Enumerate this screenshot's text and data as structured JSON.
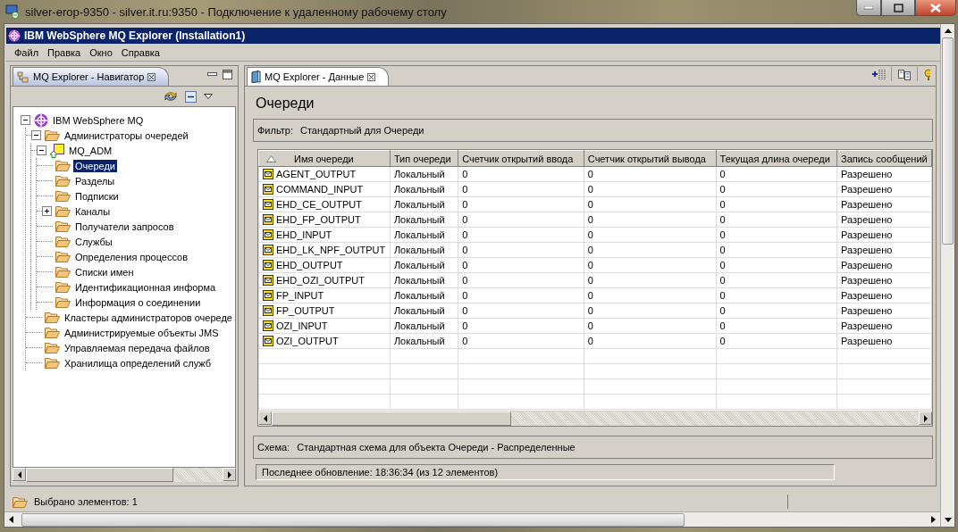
{
  "remote_window": {
    "title": "silver-erop-9350 - silver.it.ru:9350 - Подключение к удаленному рабочему столу"
  },
  "app": {
    "title": "IBM WebSphere MQ Explorer (Installation1)"
  },
  "menu": [
    "Файл",
    "Правка",
    "Окно",
    "Справка"
  ],
  "navigator": {
    "tab": {
      "label": "MQ Explorer - Навигатор",
      "active": true
    },
    "tree": [
      {
        "label": "IBM WebSphere MQ",
        "kind": "root",
        "expanded": true,
        "selected": false,
        "children": [
          {
            "label": "Администраторы очередей",
            "kind": "folder",
            "expanded": true,
            "selected": false,
            "children": [
              {
                "label": "MQ_ADM",
                "kind": "queue-manager",
                "expanded": true,
                "selected": false,
                "children": [
                  {
                    "label": "Очереди",
                    "kind": "folder",
                    "selected": true
                  },
                  {
                    "label": "Разделы",
                    "kind": "folder",
                    "selected": false
                  },
                  {
                    "label": "Подписки",
                    "kind": "folder",
                    "selected": false
                  },
                  {
                    "label": "Каналы",
                    "kind": "folder",
                    "expanded": false,
                    "selected": false
                  },
                  {
                    "label": "Получатели запросов",
                    "kind": "folder",
                    "selected": false
                  },
                  {
                    "label": "Службы",
                    "kind": "folder",
                    "selected": false
                  },
                  {
                    "label": "Определения процессов",
                    "kind": "folder",
                    "selected": false
                  },
                  {
                    "label": "Списки имен",
                    "kind": "folder",
                    "selected": false
                  },
                  {
                    "label": "Идентификационная информа",
                    "kind": "folder",
                    "selected": false
                  },
                  {
                    "label": "Информация о соединении",
                    "kind": "folder",
                    "selected": false
                  }
                ]
              }
            ]
          },
          {
            "label": "Кластеры администраторов очереде",
            "kind": "folder",
            "selected": false
          },
          {
            "label": "Администрируемые объекты JMS",
            "kind": "folder",
            "selected": false
          },
          {
            "label": "Управляемая передача файлов",
            "kind": "folder",
            "selected": false
          },
          {
            "label": "Хранилища определений служб",
            "kind": "folder",
            "selected": false
          }
        ]
      }
    ]
  },
  "content": {
    "tab": {
      "label": "MQ Explorer - Данные",
      "active": false
    },
    "heading": "Очереди",
    "filter": {
      "label": "Фильтр:",
      "value": "Стандартный для Очереди"
    },
    "table": {
      "columns": [
        {
          "label": "Имя очереди",
          "sorted": true
        },
        {
          "label": "Тип очереди",
          "sorted": false
        },
        {
          "label": "Счетчик открытий ввода",
          "sorted": false
        },
        {
          "label": "Счетчик открытий вывода",
          "sorted": false
        },
        {
          "label": "Текущая длина очереди",
          "sorted": false
        },
        {
          "label": "Запись сообщений",
          "sorted": false
        }
      ],
      "rows": [
        {
          "cells": [
            "AGENT_OUTPUT",
            "Локальный",
            "0",
            "0",
            "0",
            "Разрешено"
          ]
        },
        {
          "cells": [
            "COMMAND_INPUT",
            "Локальный",
            "0",
            "0",
            "0",
            "Разрешено"
          ]
        },
        {
          "cells": [
            "EHD_CE_OUTPUT",
            "Локальный",
            "0",
            "0",
            "0",
            "Разрешено"
          ]
        },
        {
          "cells": [
            "EHD_FP_OUTPUT",
            "Локальный",
            "0",
            "0",
            "0",
            "Разрешено"
          ]
        },
        {
          "cells": [
            "EHD_INPUT",
            "Локальный",
            "0",
            "0",
            "0",
            "Разрешено"
          ]
        },
        {
          "cells": [
            "EHD_LK_NPF_OUTPUT",
            "Локальный",
            "0",
            "0",
            "0",
            "Разрешено"
          ]
        },
        {
          "cells": [
            "EHD_OUTPUT",
            "Локальный",
            "0",
            "0",
            "0",
            "Разрешено"
          ]
        },
        {
          "cells": [
            "EHD_OZI_OUTPUT",
            "Локальный",
            "0",
            "0",
            "0",
            "Разрешено"
          ]
        },
        {
          "cells": [
            "FP_INPUT",
            "Локальный",
            "0",
            "0",
            "0",
            "Разрешено"
          ]
        },
        {
          "cells": [
            "FP_OUTPUT",
            "Локальный",
            "0",
            "0",
            "0",
            "Разрешено"
          ]
        },
        {
          "cells": [
            "OZI_INPUT",
            "Локальный",
            "0",
            "0",
            "0",
            "Разрешено"
          ]
        },
        {
          "cells": [
            "OZI_OUTPUT",
            "Локальный",
            "0",
            "0",
            "0",
            "Разрешено"
          ]
        }
      ]
    },
    "schema": {
      "label": "Схема:",
      "value": "Стандартная схема для объекта Очереди - Распределенные"
    },
    "last_update": "Последнее обновление: 18:36:34 (из 12 элементов)"
  },
  "status_bar": {
    "text": "Выбрано элементов: 1"
  }
}
